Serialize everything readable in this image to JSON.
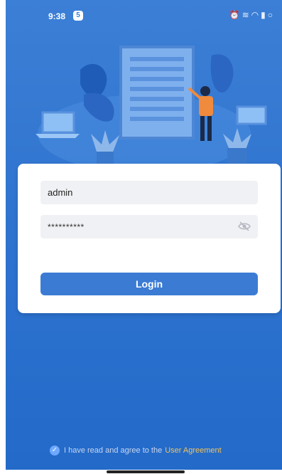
{
  "status_bar": {
    "time": "9:38",
    "badge": "5",
    "icons": [
      "alarm-icon",
      "vibrate-icon",
      "wifi-icon",
      "signal-icon",
      "battery-icon"
    ]
  },
  "login_form": {
    "username_value": "admin",
    "password_value": "**********",
    "login_label": "Login"
  },
  "agreement": {
    "text": "I have read and agree to the",
    "link_label": "User Agreement",
    "checked": true
  },
  "colors": {
    "background": "#2f74cf",
    "button": "#3b7bd4",
    "link": "#f2c35a"
  }
}
